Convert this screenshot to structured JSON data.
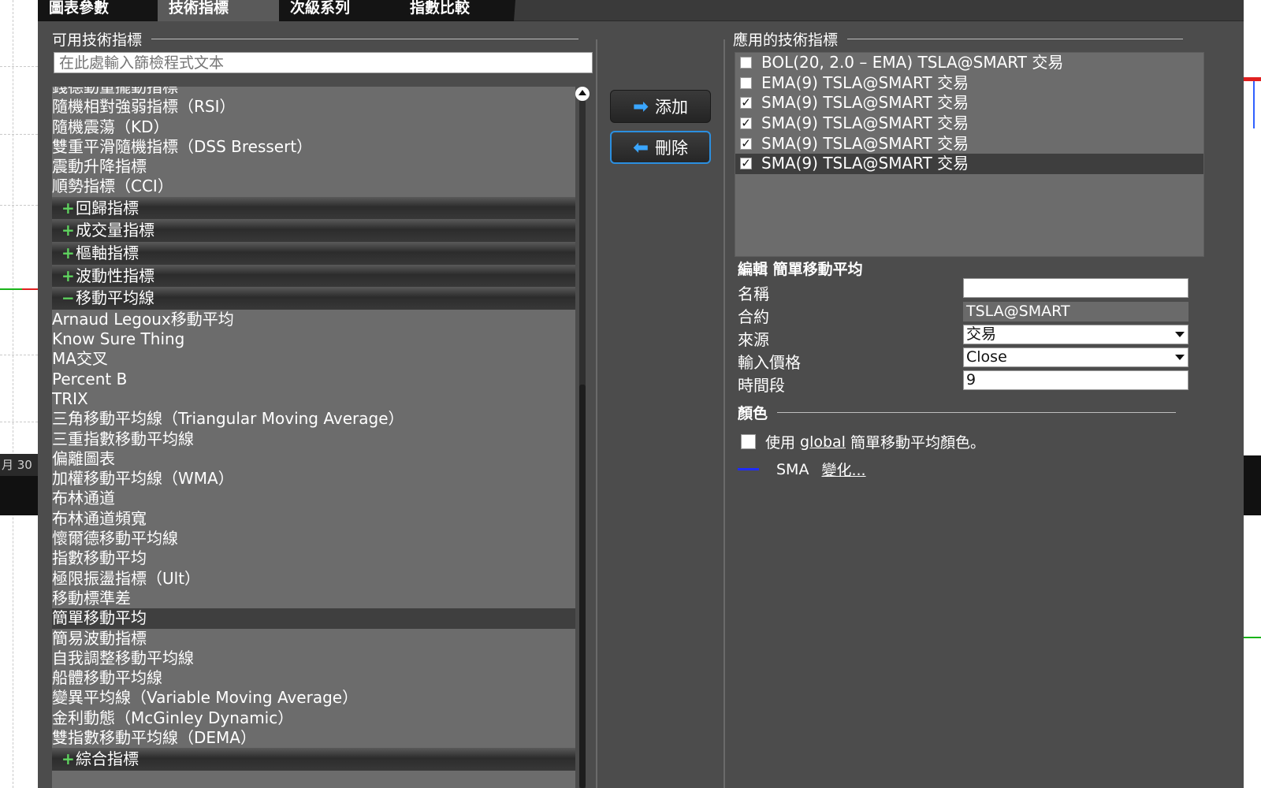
{
  "background": {
    "date_label": "月 30"
  },
  "tabs": [
    {
      "label": "圖表參數",
      "active": false
    },
    {
      "label": "技術指標",
      "active": true
    },
    {
      "label": "次級系列",
      "active": false
    },
    {
      "label": "指數比較",
      "active": false
    }
  ],
  "available": {
    "title": "可用技術指標",
    "filter_placeholder": "在此處輸入篩檢程式文本",
    "items": [
      {
        "type": "item",
        "label": "錢德動量擺動指標"
      },
      {
        "type": "item",
        "label": "隨機相對強弱指標（RSI）"
      },
      {
        "type": "item",
        "label": "隨機震蕩（KD）"
      },
      {
        "type": "item",
        "label": "雙重平滑隨機指標（DSS Bressert）"
      },
      {
        "type": "item",
        "label": "震動升降指標"
      },
      {
        "type": "item",
        "label": "順勢指標（CCI）"
      },
      {
        "type": "group",
        "sign": "+",
        "label": "回歸指標"
      },
      {
        "type": "group",
        "sign": "+",
        "label": "成交量指標"
      },
      {
        "type": "group",
        "sign": "+",
        "label": "樞軸指標"
      },
      {
        "type": "group",
        "sign": "+",
        "label": "波動性指標"
      },
      {
        "type": "group",
        "sign": "−",
        "label": "移動平均線"
      },
      {
        "type": "item",
        "label": "Arnaud Legoux移動平均"
      },
      {
        "type": "item",
        "label": "Know Sure Thing"
      },
      {
        "type": "item",
        "label": "MA交叉"
      },
      {
        "type": "item",
        "label": "Percent B"
      },
      {
        "type": "item",
        "label": "TRIX"
      },
      {
        "type": "item",
        "label": "三角移動平均線（Triangular Moving Average）"
      },
      {
        "type": "item",
        "label": "三重指數移動平均線"
      },
      {
        "type": "item",
        "label": "偏離圖表"
      },
      {
        "type": "item",
        "label": "加權移動平均線（WMA）"
      },
      {
        "type": "item",
        "label": "布林通道"
      },
      {
        "type": "item",
        "label": "布林通道頻寬"
      },
      {
        "type": "item",
        "label": "懷爾德移動平均線"
      },
      {
        "type": "item",
        "label": "指數移動平均"
      },
      {
        "type": "item",
        "label": "極限振盪指標（Ult）"
      },
      {
        "type": "item",
        "label": "移動標準差"
      },
      {
        "type": "item",
        "label": "簡單移動平均",
        "selected": true
      },
      {
        "type": "item",
        "label": "簡易波動指標"
      },
      {
        "type": "item",
        "label": "自我調整移動平均線"
      },
      {
        "type": "item",
        "label": "船體移動平均線"
      },
      {
        "type": "item",
        "label": "變異平均線（Variable Moving Average）"
      },
      {
        "type": "item",
        "label": "金利動態（McGinley Dynamic）"
      },
      {
        "type": "item",
        "label": "雙指數移動平均線（DEMA）"
      },
      {
        "type": "group",
        "sign": "+",
        "label": "綜合指標"
      }
    ]
  },
  "buttons": {
    "add_label": "添加",
    "remove_label": "刪除"
  },
  "applied": {
    "title": "應用的技術指標",
    "items": [
      {
        "label": "BOL(20, 2.0 – EMA) TSLA@SMART 交易",
        "checked": false
      },
      {
        "label": "EMA(9) TSLA@SMART 交易",
        "checked": false
      },
      {
        "label": "SMA(9) TSLA@SMART 交易",
        "checked": true
      },
      {
        "label": "SMA(9) TSLA@SMART 交易",
        "checked": true
      },
      {
        "label": "SMA(9) TSLA@SMART 交易",
        "checked": true
      },
      {
        "label": "SMA(9) TSLA@SMART 交易",
        "checked": true,
        "selected": true
      }
    ]
  },
  "edit": {
    "title": "編輯 簡單移動平均",
    "name_label": "名稱",
    "name_value": "",
    "contract_label": "合約",
    "contract_value": "TSLA@SMART",
    "source_label": "來源",
    "source_value": "交易",
    "price_label": "輸入價格",
    "price_value": "Close",
    "period_label": "時間段",
    "period_value": "9"
  },
  "color": {
    "title": "顏色",
    "use_prefix": "使用",
    "use_link": "global",
    "use_suffix": "簡單移動平均顏色。",
    "series_name": "SMA",
    "change_link": "變化...",
    "swatch_color": "#1f2bff"
  }
}
